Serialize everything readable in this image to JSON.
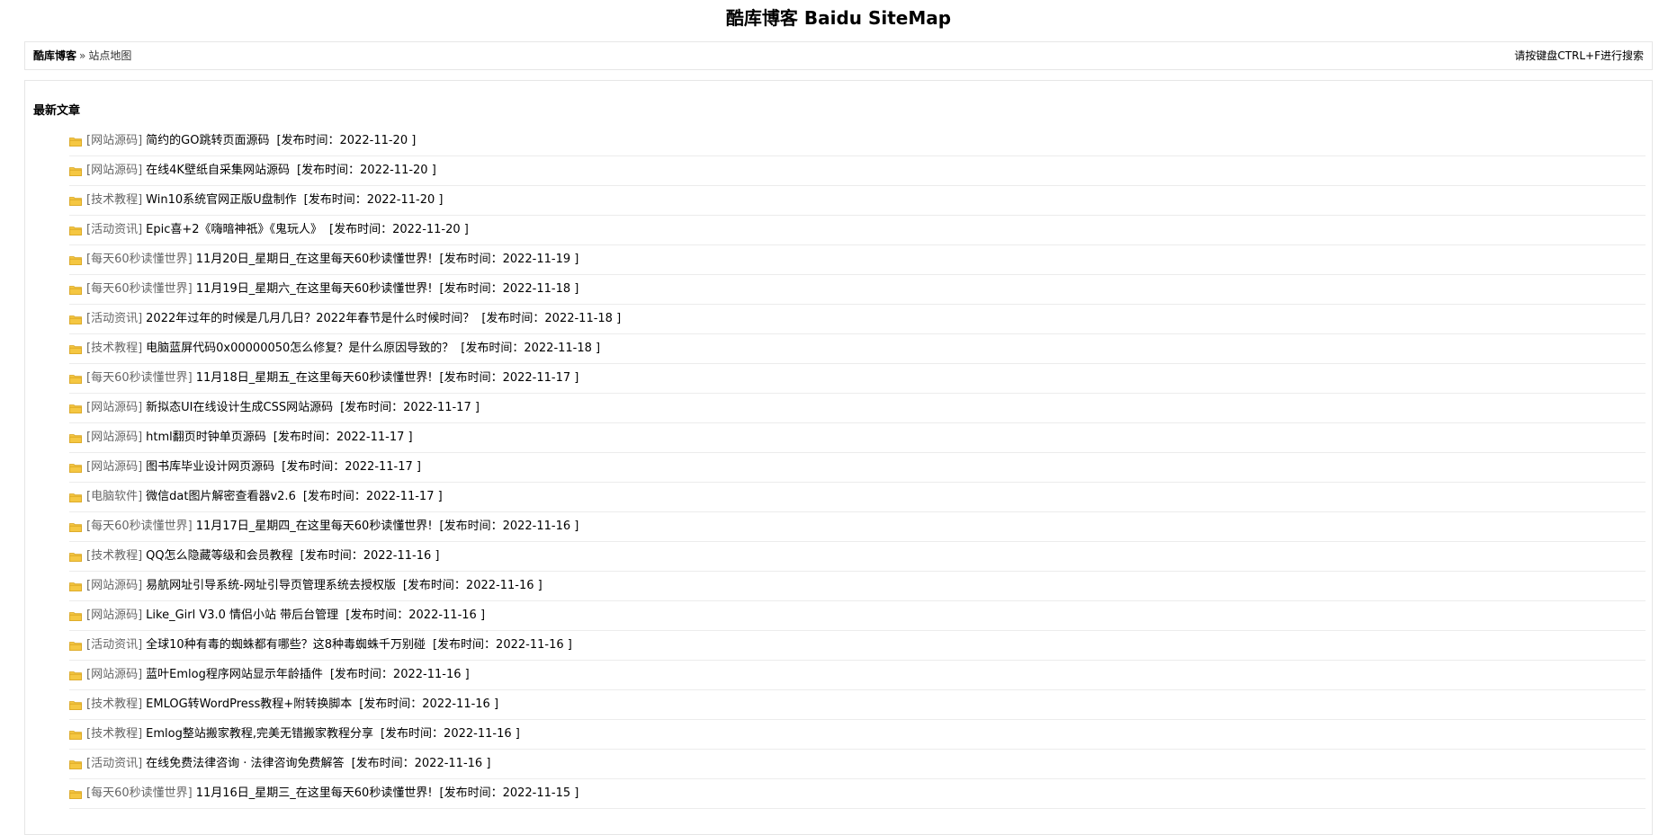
{
  "page": {
    "title": "酷库博客 Baidu SiteMap"
  },
  "breadcrumb": {
    "home": "酷库博客",
    "separator": "»",
    "current": "站点地图"
  },
  "hint": "请按键盘CTRL+F进行搜索",
  "section": {
    "heading": "最新文章"
  },
  "colors": {
    "folder": "#f5c742",
    "folder_dark": "#d9a521",
    "border": "#e6e6e6",
    "category_text": "#666666"
  },
  "articles": [
    {
      "category": "[网站源码]",
      "title": "简约的GO跳转页面源码",
      "date": "[发布时间：2022-11-20 ]"
    },
    {
      "category": "[网站源码]",
      "title": "在线4K壁纸自采集网站源码",
      "date": "[发布时间：2022-11-20 ]"
    },
    {
      "category": "[技术教程]",
      "title": "Win10系统官网正版U盘制作",
      "date": "[发布时间：2022-11-20 ]"
    },
    {
      "category": "[活动资讯]",
      "title": "Epic喜+2《嗨暗神祇》《鬼玩人》",
      "date": "[发布时间：2022-11-20 ]"
    },
    {
      "category": "[每天60秒读懂世界]",
      "title": "11月20日_星期日_在这里每天60秒读懂世界!",
      "date": "[发布时间：2022-11-19 ]"
    },
    {
      "category": "[每天60秒读懂世界]",
      "title": "11月19日_星期六_在这里每天60秒读懂世界!",
      "date": "[发布时间：2022-11-18 ]"
    },
    {
      "category": "[活动资讯]",
      "title": "2022年过年的时候是几月几日？2022年春节是什么时候时间？",
      "date": "[发布时间：2022-11-18 ]"
    },
    {
      "category": "[技术教程]",
      "title": "电脑蓝屏代码0x00000050怎么修复？是什么原因导致的？",
      "date": "[发布时间：2022-11-18 ]"
    },
    {
      "category": "[每天60秒读懂世界]",
      "title": "11月18日_星期五_在这里每天60秒读懂世界!",
      "date": "[发布时间：2022-11-17 ]"
    },
    {
      "category": "[网站源码]",
      "title": "新拟态UI在线设计生成CSS网站源码",
      "date": "[发布时间：2022-11-17 ]"
    },
    {
      "category": "[网站源码]",
      "title": "html翻页时钟单页源码",
      "date": "[发布时间：2022-11-17 ]"
    },
    {
      "category": "[网站源码]",
      "title": "图书库毕业设计网页源码",
      "date": "[发布时间：2022-11-17 ]"
    },
    {
      "category": "[电脑软件]",
      "title": "微信dat图片解密查看器v2.6",
      "date": "[发布时间：2022-11-17 ]"
    },
    {
      "category": "[每天60秒读懂世界]",
      "title": "11月17日_星期四_在这里每天60秒读懂世界!",
      "date": "[发布时间：2022-11-16 ]"
    },
    {
      "category": "[技术教程]",
      "title": "QQ怎么隐藏等级和会员教程",
      "date": "[发布时间：2022-11-16 ]"
    },
    {
      "category": "[网站源码]",
      "title": "易航网址引导系统-网址引导页管理系统去授权版",
      "date": "[发布时间：2022-11-16 ]"
    },
    {
      "category": "[网站源码]",
      "title": "Like_Girl V3.0 情侣小站 带后台管理",
      "date": "[发布时间：2022-11-16 ]"
    },
    {
      "category": "[活动资讯]",
      "title": "全球10种有毒的蜘蛛都有哪些？这8种毒蜘蛛千万别碰",
      "date": "[发布时间：2022-11-16 ]"
    },
    {
      "category": "[网站源码]",
      "title": "蓝叶Emlog程序网站显示年龄插件",
      "date": "[发布时间：2022-11-16 ]"
    },
    {
      "category": "[技术教程]",
      "title": "EMLOG转WordPress教程+附转换脚本",
      "date": "[发布时间：2022-11-16 ]"
    },
    {
      "category": "[技术教程]",
      "title": "Emlog整站搬家教程,完美无错搬家教程分享",
      "date": "[发布时间：2022-11-16 ]"
    },
    {
      "category": "[活动资讯]",
      "title": "在线免费法律咨询 · 法律咨询免费解答",
      "date": "[发布时间：2022-11-16 ]"
    },
    {
      "category": "[每天60秒读懂世界]",
      "title": "11月16日_星期三_在这里每天60秒读懂世界!",
      "date": "[发布时间：2022-11-15 ]"
    }
  ]
}
